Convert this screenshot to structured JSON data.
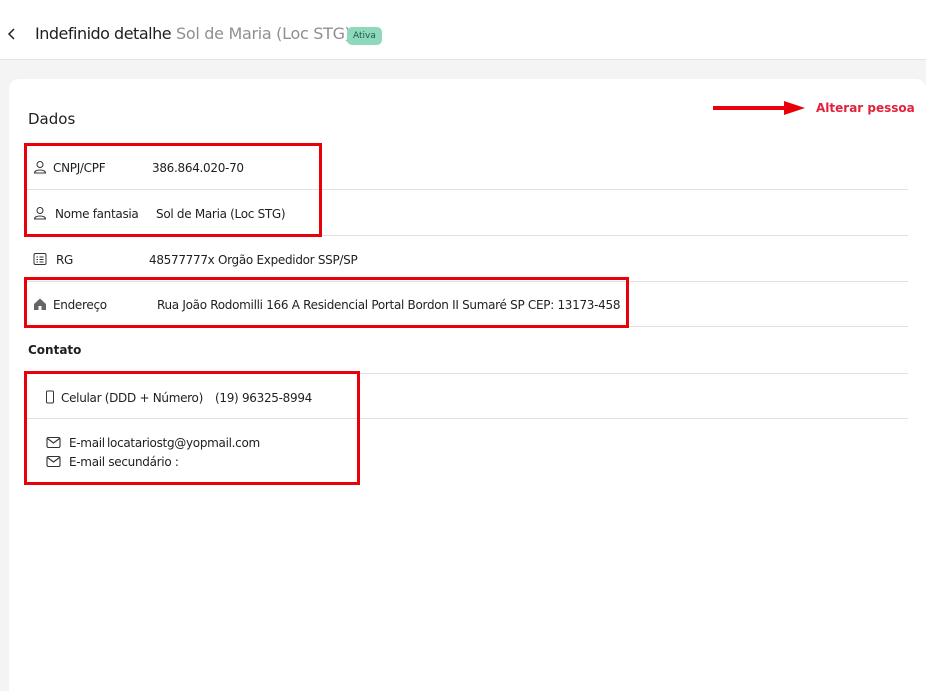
{
  "header": {
    "title": "Indefinido detalhe",
    "subtitle": "Sol de Maria (Loc STG)",
    "badge": "Ativa"
  },
  "dados": {
    "title": "Dados",
    "alter_label": "Alterar pessoa",
    "rows": [
      {
        "icon": "user-icon",
        "label": "CNPJ/CPF",
        "value": "386.864.020-70"
      },
      {
        "icon": "user-icon",
        "label": "Nome fantasia",
        "value": "Sol de Maria (Loc STG)"
      },
      {
        "icon": "id-card-icon",
        "label": "RG",
        "value": "48577777x Orgão Expedidor SSP/SP"
      },
      {
        "icon": "home-icon",
        "label": "Endereço",
        "value": "Rua João Rodomilli 166 A Residencial Portal Bordon II Sumaré SP CEP: 13173-458"
      }
    ]
  },
  "contato": {
    "title": "Contato",
    "phone": {
      "icon": "phone-icon",
      "label": "Celular (DDD + Número)",
      "value": "(19) 96325-8994"
    },
    "email": {
      "icon": "mail-icon",
      "label": "E-mail",
      "value": "locatariostg@yopmail.com"
    },
    "email_secondary": {
      "icon": "mail-icon",
      "label": "E-mail secundário :",
      "value": ""
    }
  },
  "colors": {
    "accent": "#e3213b",
    "badge_bg": "#8ed8bb",
    "highlight": "#e8000b"
  }
}
